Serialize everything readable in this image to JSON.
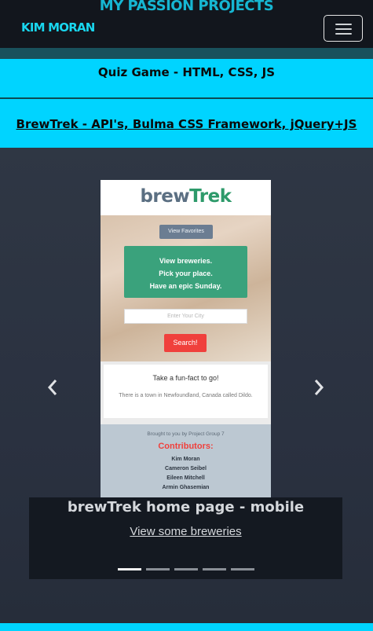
{
  "header": {
    "section_title": "My Passion Projects",
    "brand": "Kim Moran",
    "menu_icon": "hamburger-menu-icon"
  },
  "projects": [
    {
      "label": "Quiz Game - HTML, CSS, JS"
    },
    {
      "label": "BrewTrek - API's, Bulma CSS Framework, jQuery+JS"
    }
  ],
  "carousel": {
    "slide": {
      "app_logo_part1": "brew",
      "app_logo_part2": "Trek",
      "favorites_button": "View Favorites",
      "hero_lines": [
        "View breweries.",
        "Pick your place.",
        "Have an epic Sunday."
      ],
      "city_placeholder": "Enter Your City",
      "search_button": "Search!",
      "fact_title": "Take a fun-fact to go!",
      "fact_text": "There is a town in Newfoundland, Canada called Dildo.",
      "footer_by": "Brought to you by Project Group 7",
      "contributors_title": "Contributors:",
      "contributors": [
        "Kim Moran",
        "Cameron Seibel",
        "Eileen Mitchell",
        "Armin Ghasemian"
      ]
    },
    "caption_title": "brewTrek home page - mobile",
    "caption_link": "View some breweries",
    "indicator_count": 5,
    "active_index": 0,
    "prev_icon": "chevron-left-icon",
    "next_icon": "chevron-right-icon"
  },
  "colors": {
    "accent": "#00d4ff",
    "brand": "#19d6ee",
    "background": "#262d3a"
  }
}
